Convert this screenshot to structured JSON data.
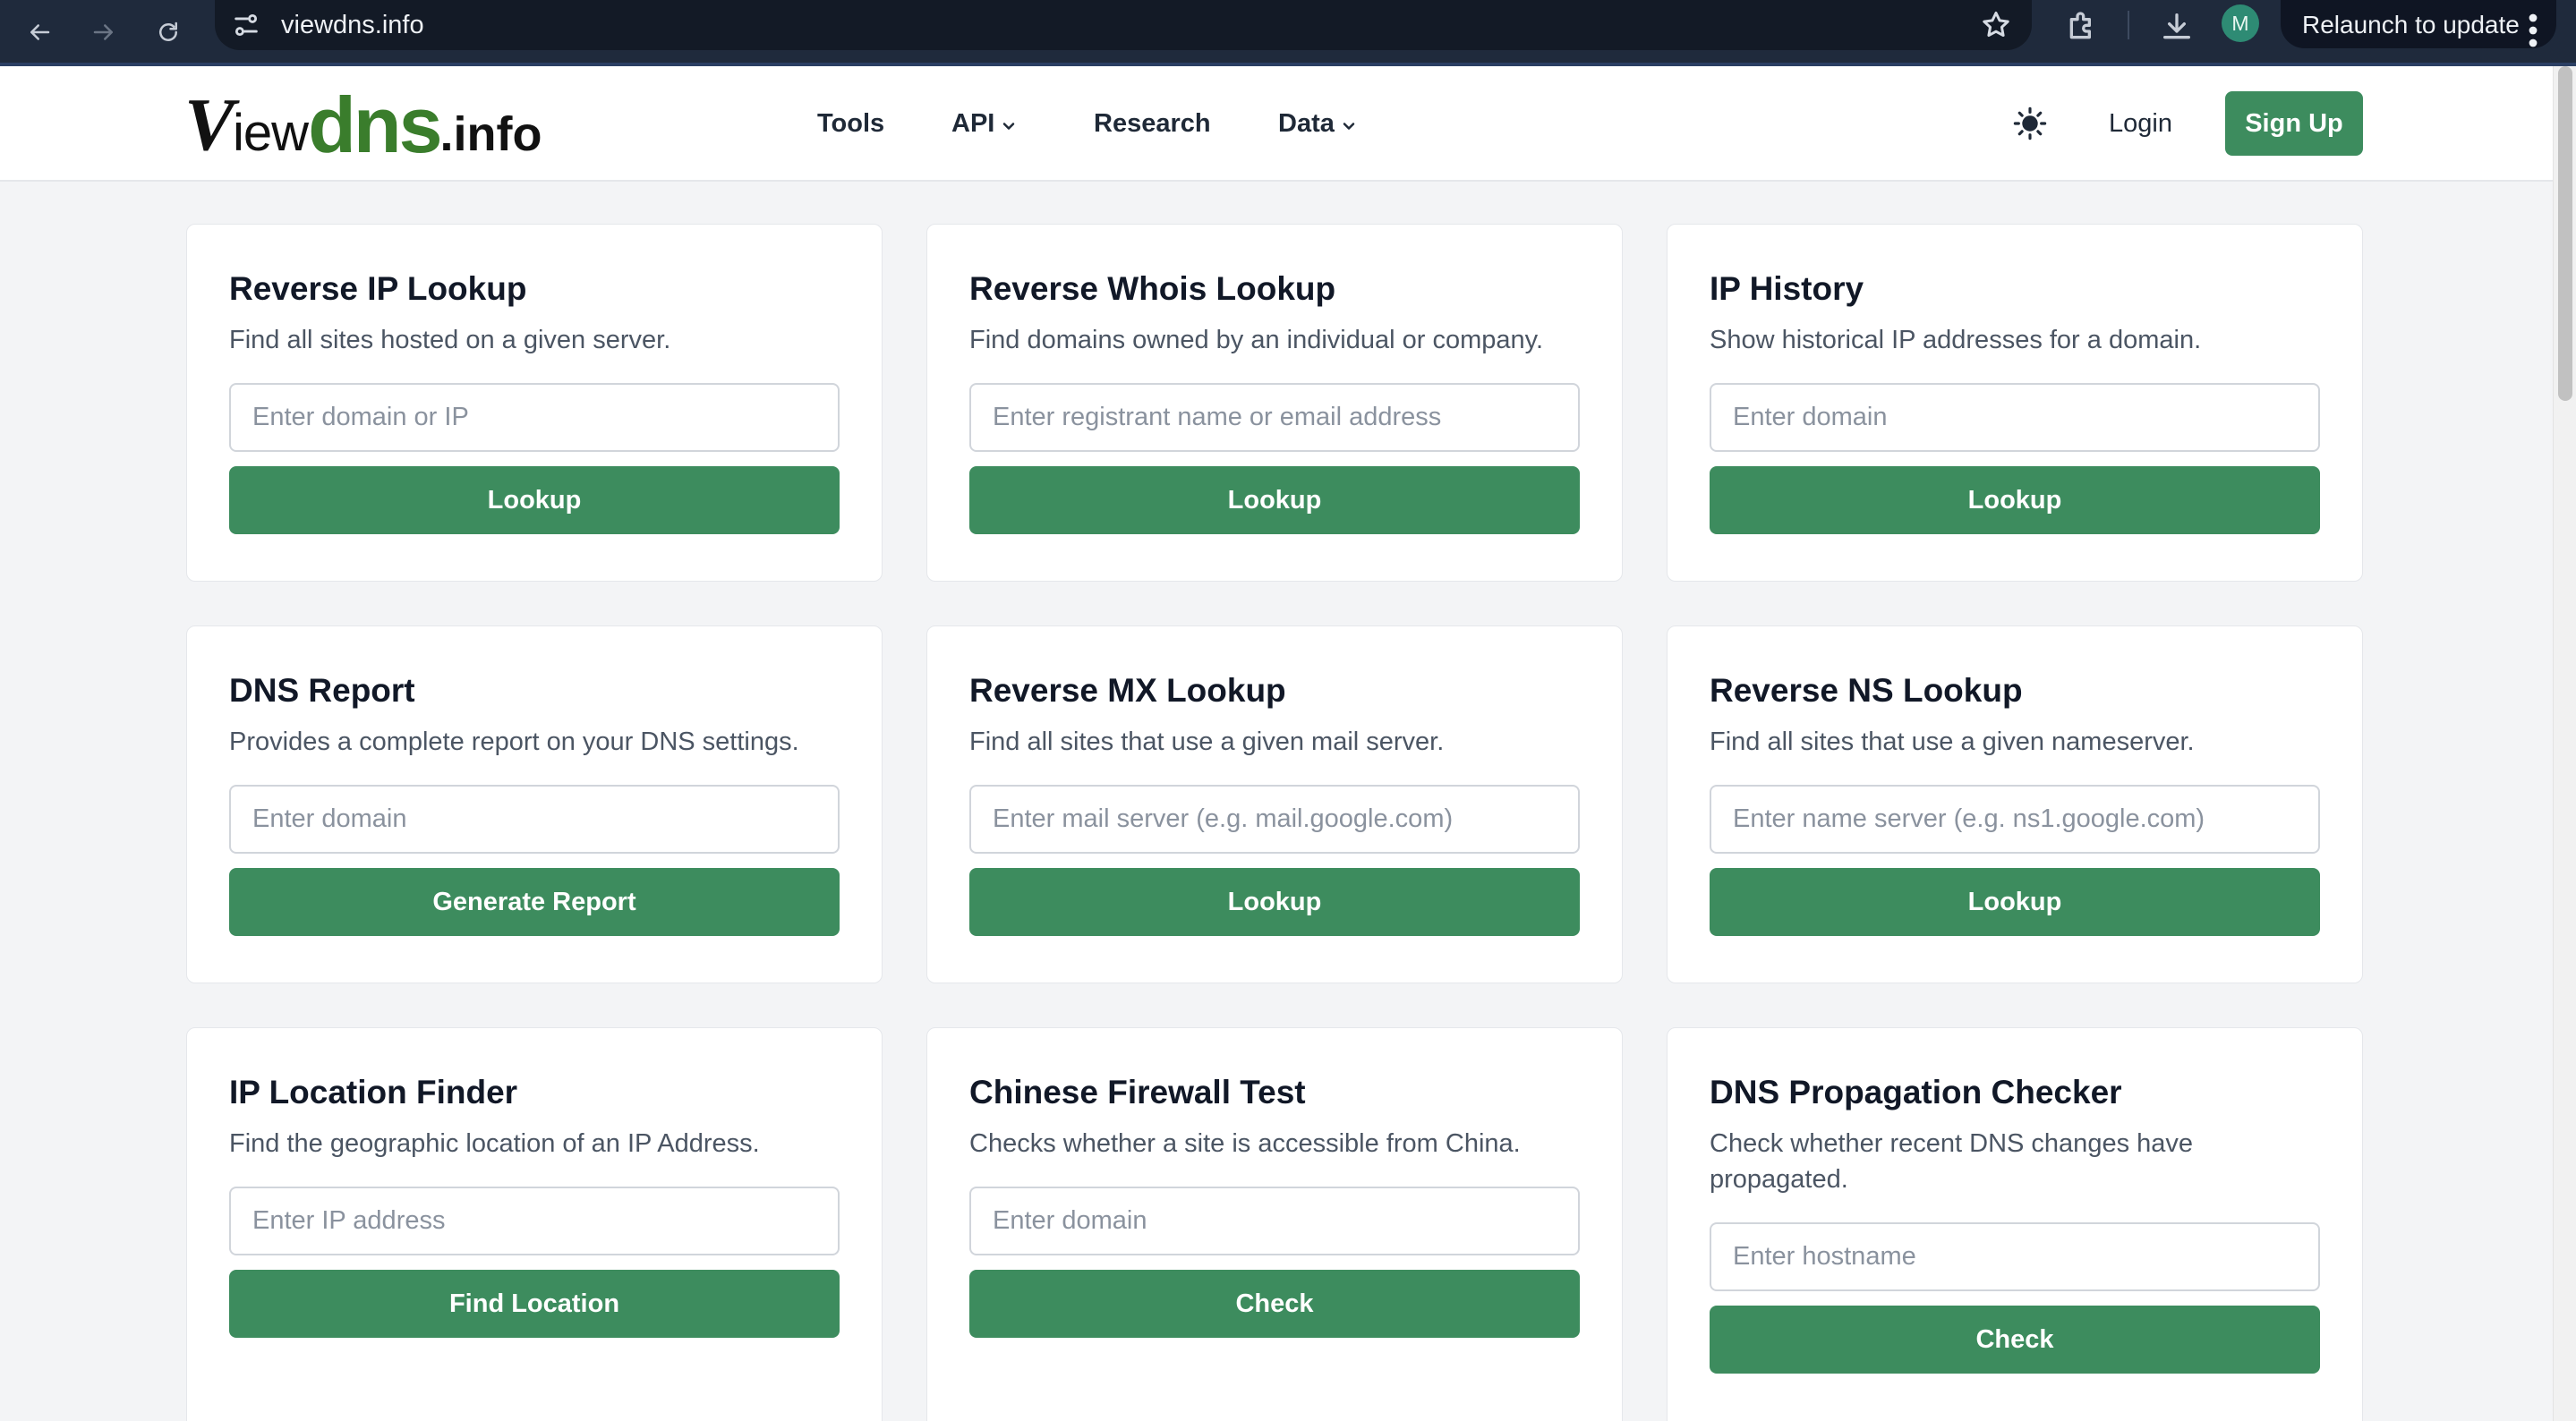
{
  "browser": {
    "url": "viewdns.info",
    "avatar_letter": "M",
    "relaunch_label": "Relaunch to update"
  },
  "site": {
    "logo": {
      "v": "V",
      "iew": "iew",
      "dns": "dns",
      "info": ".info"
    },
    "nav": [
      {
        "label": "Tools",
        "has_dropdown": false
      },
      {
        "label": "API",
        "has_dropdown": true
      },
      {
        "label": "Research",
        "has_dropdown": false
      },
      {
        "label": "Data",
        "has_dropdown": true
      }
    ],
    "login_label": "Login",
    "signup_label": "Sign Up"
  },
  "colors": {
    "primary_green": "#3d8c5e",
    "logo_green": "#3a7d2c",
    "page_bg": "#f3f4f6",
    "chrome_bg": "#1f2a3c"
  },
  "tools": [
    {
      "title": "Reverse IP Lookup",
      "description": "Find all sites hosted on a given server.",
      "placeholder": "Enter domain or IP",
      "button": "Lookup"
    },
    {
      "title": "Reverse Whois Lookup",
      "description": "Find domains owned by an individual or company.",
      "placeholder": "Enter registrant name or email address",
      "button": "Lookup"
    },
    {
      "title": "IP History",
      "description": "Show historical IP addresses for a domain.",
      "placeholder": "Enter domain",
      "button": "Lookup"
    },
    {
      "title": "DNS Report",
      "description": "Provides a complete report on your DNS settings.",
      "placeholder": "Enter domain",
      "button": "Generate Report"
    },
    {
      "title": "Reverse MX Lookup",
      "description": "Find all sites that use a given mail server.",
      "placeholder": "Enter mail server (e.g. mail.google.com)",
      "button": "Lookup"
    },
    {
      "title": "Reverse NS Lookup",
      "description": "Find all sites that use a given nameserver.",
      "placeholder": "Enter name server (e.g. ns1.google.com)",
      "button": "Lookup"
    },
    {
      "title": "IP Location Finder",
      "description": "Find the geographic location of an IP Address.",
      "placeholder": "Enter IP address",
      "button": "Find Location"
    },
    {
      "title": "Chinese Firewall Test",
      "description": "Checks whether a site is accessible from China.",
      "placeholder": "Enter domain",
      "button": "Check"
    },
    {
      "title": "DNS Propagation Checker",
      "description": "Check whether recent DNS changes have propagated.",
      "placeholder": "Enter hostname",
      "button": "Check"
    }
  ]
}
